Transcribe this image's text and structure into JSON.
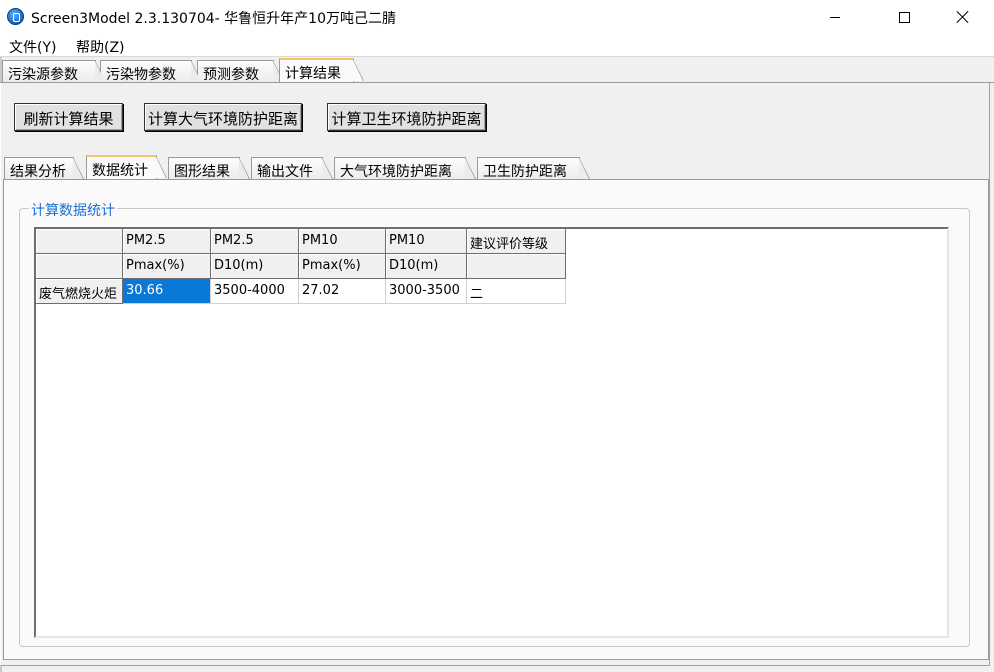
{
  "window": {
    "title": "Screen3Model 2.3.130704- 华鲁恒升年产10万吨己二腈"
  },
  "menu": {
    "items": [
      "文件(Y)",
      "帮助(Z)"
    ]
  },
  "outer_tabs": [
    "污染源参数",
    "污染物参数",
    "预测参数",
    "计算结果"
  ],
  "outer_tabs_active": "计算结果",
  "buttons": {
    "refresh": "刷新计算结果",
    "air_distance": "计算大气环境防护距离",
    "health_distance": "计算卫生环境防护距离"
  },
  "inner_tabs": [
    "结果分析",
    "数据统计",
    "图形结果",
    "输出文件",
    "大气环境防护距离",
    "卫生防护距离"
  ],
  "inner_tabs_active": "数据统计",
  "group": {
    "title": "计算数据统计"
  },
  "grid": {
    "header_row1": [
      "",
      "PM2.5",
      "PM2.5",
      "PM10",
      "PM10",
      "建议评价等级"
    ],
    "header_row2": [
      "",
      "Pmax(%)",
      "D10(m)",
      "Pmax(%)",
      "D10(m)",
      ""
    ],
    "rows": [
      {
        "label": "废气燃烧火炬",
        "cells": [
          "30.66",
          "3500-4000",
          "27.02",
          "3000-3500",
          "二"
        ]
      }
    ],
    "selected_color": "#0a78d7"
  },
  "colors": {
    "active_tab_accent": "#f5c46a",
    "group_title": "#1c6fd1"
  }
}
